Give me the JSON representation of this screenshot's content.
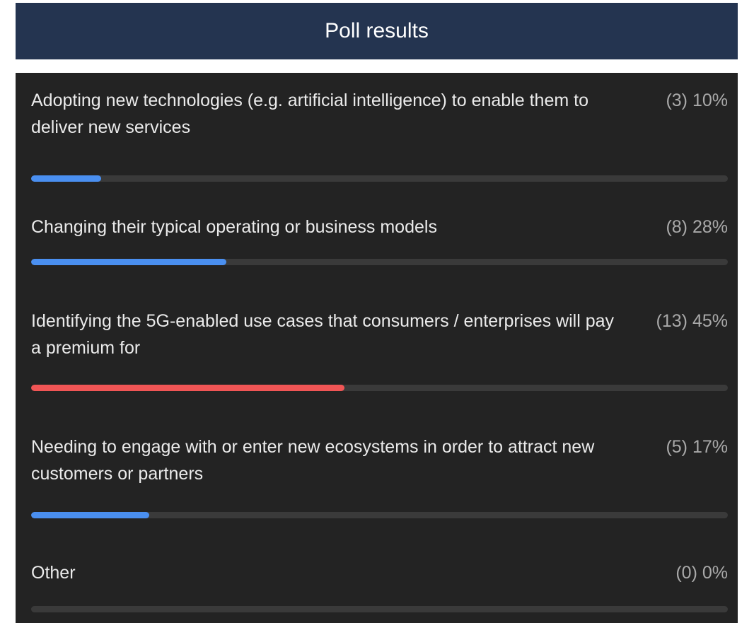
{
  "header": {
    "title": "Poll results"
  },
  "colors": {
    "normal_fill": "#4a8ff0",
    "leading_fill": "#f05555"
  },
  "options": [
    {
      "label": "Adopting new technologies (e.g. artificial intelligence) to enable them to deliver new services",
      "stat": "(3) 10%",
      "percent": 10,
      "leading": false
    },
    {
      "label": "Changing their typical operating or business models",
      "stat": "(8) 28%",
      "percent": 28,
      "leading": false
    },
    {
      "label": "Identifying the 5G-enabled use cases that consumers / enterprises will pay a premium for",
      "stat": "(13) 45%",
      "percent": 45,
      "leading": true
    },
    {
      "label": "Needing to engage with or enter new ecosystems in order to attract new customers or partners",
      "stat": "(5) 17%",
      "percent": 17,
      "leading": false
    },
    {
      "label": "Other",
      "stat": "(0) 0%",
      "percent": 0,
      "leading": false
    }
  ]
}
